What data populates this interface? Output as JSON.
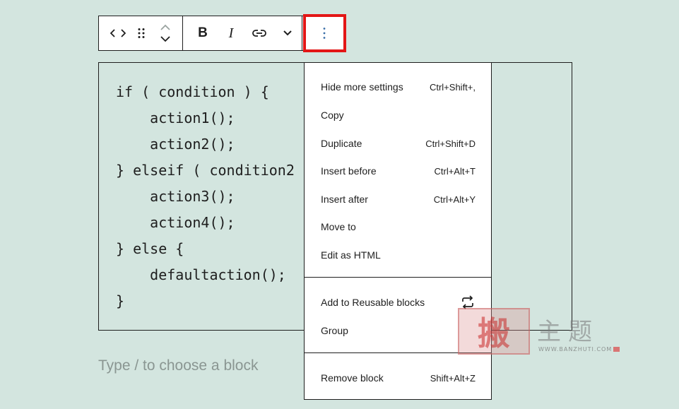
{
  "toolbar": {
    "icons": [
      "code-icon",
      "drag-handle-icon",
      "chevron-up-icon",
      "chevron-down-icon",
      "bold-icon",
      "italic-icon",
      "link-icon",
      "more-rich-text-chevron-icon",
      "vertical-ellipsis-icon"
    ],
    "bold_label": "B",
    "italic_label": "I",
    "highlight_color": "#e31616",
    "more_icon_color": "#3a6ea8"
  },
  "code_block": {
    "lines": [
      "if ( condition ) {",
      "    action1();",
      "    action2();",
      "} elseif ( condition2",
      "    action3();",
      "    action4();",
      "} else {",
      "    defaultaction();",
      "}"
    ]
  },
  "placeholder": "Type / to choose a block",
  "menu": {
    "groups": [
      {
        "items": [
          {
            "label": "Hide more settings",
            "shortcut": "Ctrl+Shift+,"
          },
          {
            "label": "Copy",
            "shortcut": ""
          },
          {
            "label": "Duplicate",
            "shortcut": "Ctrl+Shift+D"
          },
          {
            "label": "Insert before",
            "shortcut": "Ctrl+Alt+T"
          },
          {
            "label": "Insert after",
            "shortcut": "Ctrl+Alt+Y"
          },
          {
            "label": "Move to",
            "shortcut": ""
          },
          {
            "label": "Edit as HTML",
            "shortcut": ""
          }
        ]
      },
      {
        "items": [
          {
            "label": "Add to Reusable blocks",
            "icon": "reusable-block-icon"
          },
          {
            "label": "Group",
            "shortcut": ""
          }
        ]
      },
      {
        "items": [
          {
            "label": "Remove block",
            "shortcut": "Shift+Alt+Z"
          }
        ]
      }
    ]
  },
  "watermark": {
    "seal_char": "搬",
    "text": "主题",
    "url": "WWW.BANZHUTI.COM"
  },
  "colors": {
    "background": "#d3e5df",
    "border": "#1e1e1e",
    "placeholder": "#8a9692"
  }
}
